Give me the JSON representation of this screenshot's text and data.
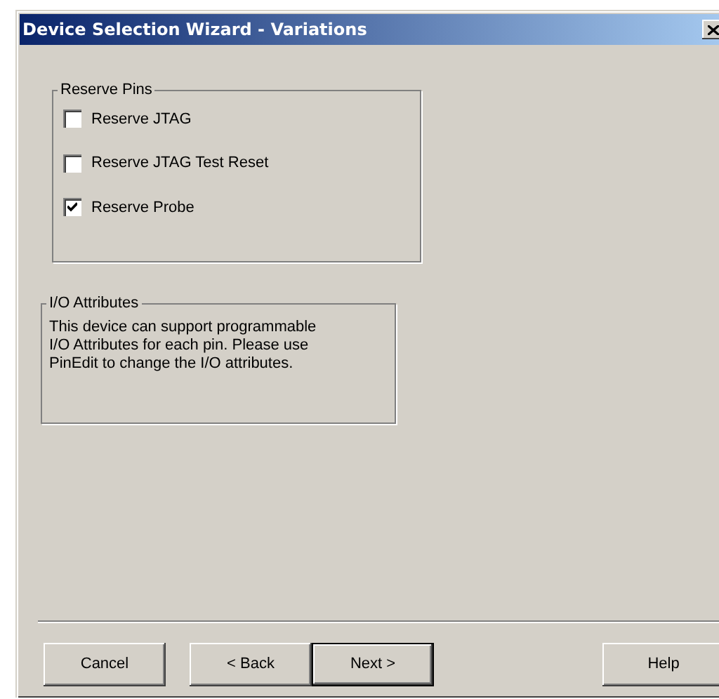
{
  "window": {
    "title": "Device Selection Wizard - Variations"
  },
  "reserve_pins": {
    "title": "Reserve Pins",
    "options": [
      {
        "label": "Reserve JTAG",
        "checked": false
      },
      {
        "label": "Reserve JTAG Test Reset",
        "checked": false
      },
      {
        "label": "Reserve Probe",
        "checked": true
      }
    ]
  },
  "io_attributes": {
    "title": "I/O Attributes",
    "text": "This device can support programmable\nI/O Attributes for each pin.  Please use\nPinEdit to change the I/O attributes."
  },
  "buttons": [
    {
      "label": "Cancel",
      "default": false
    },
    {
      "label": "< Back",
      "default": false
    },
    {
      "label": "Next >",
      "default": true
    },
    {
      "label": "Help",
      "default": false
    }
  ]
}
